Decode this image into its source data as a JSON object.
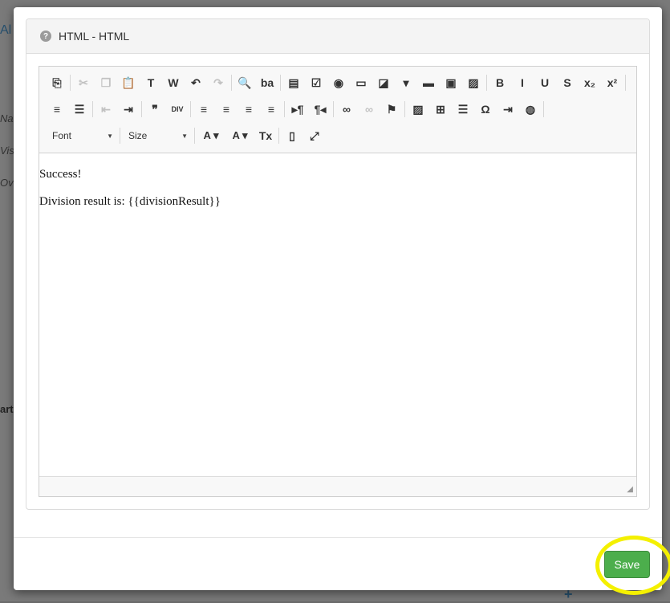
{
  "background": {
    "frag_top": "Al",
    "frag_na": "Na",
    "frag_vis": "Vis",
    "frag_ov": "Ov",
    "frag_art": "art",
    "frag_plus": "+"
  },
  "dialog": {
    "title": "HTML - HTML",
    "toolbar": {
      "row1": [
        {
          "icon": "source-icon",
          "glyph": "⎘"
        },
        {
          "icon": "cut-icon",
          "glyph": "✂",
          "disabled": true
        },
        {
          "icon": "copy-icon",
          "glyph": "❐",
          "disabled": true
        },
        {
          "icon": "paste-icon",
          "glyph": "📋"
        },
        {
          "icon": "paste-text-icon",
          "glyph": "T"
        },
        {
          "icon": "paste-word-icon",
          "glyph": "W"
        },
        {
          "icon": "undo-icon",
          "glyph": "↶"
        },
        {
          "icon": "redo-icon",
          "glyph": "↷",
          "disabled": true
        },
        {
          "icon": "find-icon",
          "glyph": "🔍"
        },
        {
          "icon": "replace-icon",
          "glyph": "ba"
        },
        {
          "icon": "form-icon",
          "glyph": "▤"
        },
        {
          "icon": "checkbox-icon",
          "glyph": "☑"
        },
        {
          "icon": "radio-icon",
          "glyph": "◉"
        },
        {
          "icon": "textfield-icon",
          "glyph": "▭"
        },
        {
          "icon": "textarea-icon",
          "glyph": "◪"
        },
        {
          "icon": "select-icon",
          "glyph": "▾"
        },
        {
          "icon": "button-icon",
          "glyph": "▬"
        },
        {
          "icon": "image-button-icon",
          "glyph": "▣"
        },
        {
          "icon": "hidden-field-icon",
          "glyph": "▨"
        },
        {
          "icon": "bold-icon",
          "glyph": "B"
        },
        {
          "icon": "italic-icon",
          "glyph": "I"
        },
        {
          "icon": "underline-icon",
          "glyph": "U"
        },
        {
          "icon": "strike-icon",
          "glyph": "S"
        },
        {
          "icon": "subscript-icon",
          "glyph": "x₂"
        },
        {
          "icon": "superscript-icon",
          "glyph": "x²"
        }
      ],
      "row2": [
        {
          "icon": "numbered-list-icon",
          "glyph": "≡"
        },
        {
          "icon": "bulleted-list-icon",
          "glyph": "☰"
        },
        {
          "icon": "outdent-icon",
          "glyph": "⇤",
          "disabled": true
        },
        {
          "icon": "indent-icon",
          "glyph": "⇥"
        },
        {
          "icon": "blockquote-icon",
          "glyph": "❞"
        },
        {
          "icon": "div-icon",
          "glyph": "DIV"
        },
        {
          "icon": "align-left-icon",
          "glyph": "≡"
        },
        {
          "icon": "align-center-icon",
          "glyph": "≡"
        },
        {
          "icon": "align-right-icon",
          "glyph": "≡"
        },
        {
          "icon": "justify-icon",
          "glyph": "≡"
        },
        {
          "icon": "ltr-icon",
          "glyph": "▸¶"
        },
        {
          "icon": "rtl-icon",
          "glyph": "¶◂"
        },
        {
          "icon": "link-icon",
          "glyph": "∞"
        },
        {
          "icon": "unlink-icon",
          "glyph": "∞",
          "disabled": true
        },
        {
          "icon": "anchor-icon",
          "glyph": "⚑"
        },
        {
          "icon": "image-icon",
          "glyph": "▨"
        },
        {
          "icon": "table-icon",
          "glyph": "⊞"
        },
        {
          "icon": "horizontal-rule-icon",
          "glyph": "☰"
        },
        {
          "icon": "special-char-icon",
          "glyph": "Ω"
        },
        {
          "icon": "page-break-icon",
          "glyph": "⇥"
        },
        {
          "icon": "iframe-icon",
          "glyph": "◍"
        }
      ],
      "font_label": "Font",
      "size_label": "Size",
      "row3": [
        {
          "icon": "text-color-icon",
          "glyph": "A"
        },
        {
          "icon": "bg-color-icon",
          "glyph": "A"
        },
        {
          "icon": "remove-format-icon",
          "glyph": "Tx"
        },
        {
          "icon": "templates-icon",
          "glyph": "▯"
        },
        {
          "icon": "maximize-icon",
          "glyph": "⤢"
        }
      ]
    },
    "content": {
      "line1": "Success!",
      "line2": "Division result is: {{divisionResult}}"
    },
    "save_label": "Save"
  }
}
